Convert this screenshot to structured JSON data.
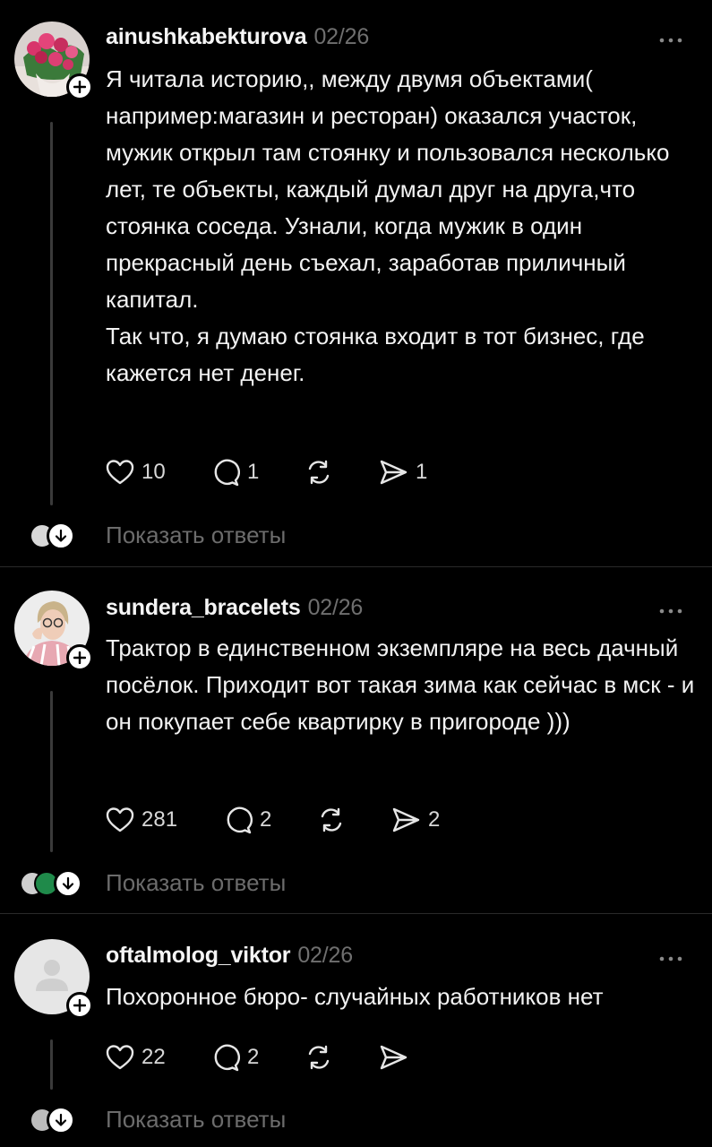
{
  "posts": [
    {
      "username": "ainushkabekturova",
      "date": "02/26",
      "text": "Я читала историю,, между двумя объектами( например:магазин и ресторан) оказался участок, мужик открыл там стоянку и пользовался несколько лет, те объекты, каждый думал друг на друга,что стоянка соседа. Узнали, когда мужик в один прекрасный день съехал, заработав приличный капитал.\nТак что, я думаю стоянка входит в тот бизнес, где кажется нет денег.",
      "likes": "10",
      "comments": "1",
      "shares": "1",
      "show_replies": "Показать ответы"
    },
    {
      "username": "sundera_bracelets",
      "date": "02/26",
      "text": "Трактор в единственном экземпляре на весь дачный посёлок. Приходит вот такая зима как сейчас в мск - и он покупает себе квартирку в пригороде )))",
      "likes": "281",
      "comments": "2",
      "shares": "2",
      "show_replies": "Показать ответы"
    },
    {
      "username": "oftalmolog_viktor",
      "date": "02/26",
      "text": "Похоронное бюро- случайных работников нет",
      "likes": "22",
      "comments": "2",
      "shares": "",
      "show_replies": "Показать ответы"
    }
  ],
  "icons": {
    "like": "heart-icon",
    "comment": "comment-bubble-icon",
    "repost": "repost-icon",
    "share": "send-icon",
    "more": "more-dots-icon",
    "follow": "plus-icon",
    "expand": "arrow-down-icon"
  },
  "colors": {
    "background": "#000000",
    "text": "#f3f3f3",
    "muted": "#6f6f6f",
    "divider": "#2a2a2a"
  }
}
